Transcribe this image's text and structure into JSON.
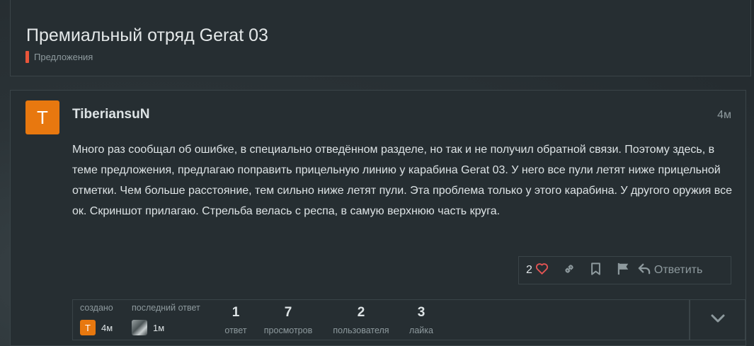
{
  "topic": {
    "title": "Премиальный отряд Gerat 03",
    "category": "Предложения",
    "category_color": "#e9553a"
  },
  "post": {
    "avatar_letter": "T",
    "avatar_color": "#e8780f",
    "username": "TiberiansuN",
    "date": "4м",
    "body": "Много раз сообщал об ошибке, в специально отведённом разделе, но так и не получил обратной связи. Поэтому здесь, в теме предложения, предлагаю поправить прицельную линию у карабина Gerat 03. У него все пули летят ниже прицельной отметки. Чем больше расстояние, тем сильно ниже летят пули. Эта проблема только у этого карабина. У другого оружия все ок. Скриншот прилагаю. Стрельба велась с респа, в самую верхнюю часть круга.",
    "actions": {
      "like_count": "2",
      "reply_label": "Ответить"
    }
  },
  "topic_map": {
    "created_label": "создано",
    "created_avatar_letter": "T",
    "created_time": "4м",
    "last_reply_label": "последний ответ",
    "last_reply_time": "1м",
    "stats": [
      {
        "num": "1",
        "label": "ответ"
      },
      {
        "num": "7",
        "label": "просмотров"
      },
      {
        "num": "2",
        "label": "пользователя"
      },
      {
        "num": "3",
        "label": "лайка"
      }
    ]
  },
  "icons": [
    "heart-icon",
    "link-icon",
    "bookmark-icon",
    "flag-icon",
    "reply-icon",
    "chevron-down-icon"
  ],
  "colors": {
    "accent_like": "#e45454",
    "muted": "#8e9a9e"
  }
}
